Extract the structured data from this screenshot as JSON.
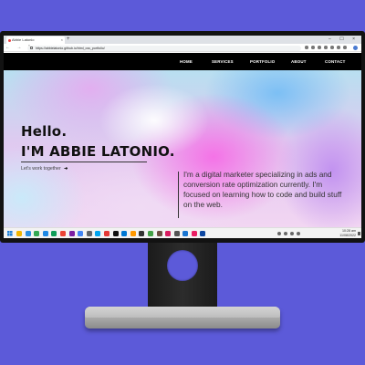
{
  "browser": {
    "tab_title": "Abbie Latonio",
    "tab_close": "×",
    "new_tab": "+",
    "window_controls": "– ☐ ×",
    "nav_buttons": "← → ↻",
    "url": "https://abbielatonio.github.io/html_css_portfolio/"
  },
  "site": {
    "nav": {
      "home": "HOME",
      "services": "SERVICES",
      "portfolio": "PORTFOLIO",
      "about": "ABOUT",
      "contact": "CONTACT"
    },
    "hero": {
      "hello": "Hello.",
      "name": "I'M ABBIE LATONIO.",
      "cta": "Let's work together",
      "cta_arrow": "➜",
      "bio": "I'm a digital marketer specializing in ads and conversion rate optimization currently. I'm focused on learning how to code and build stuff on the web."
    }
  },
  "taskbar": {
    "time": "10:28 am",
    "date": "11/08/2022",
    "app_colors": [
      "#f0b400",
      "#2a8fe0",
      "#34a853",
      "#1e88e5",
      "#0f9d58",
      "#ea4335",
      "#7b1fa2",
      "#4285f4",
      "#5f6368",
      "#00a4ef",
      "#e53935",
      "#111111",
      "#0078d4",
      "#ff9800",
      "#333333",
      "#43a047",
      "#6d4c41",
      "#d81b60",
      "#555555",
      "#1976d2",
      "#e91e63",
      "#0d47a1"
    ]
  },
  "colors": {
    "background": "#5c5ad9",
    "nav_bg": "#000000",
    "accent_pink": "#f56ee6",
    "accent_blue": "#78bef5"
  }
}
